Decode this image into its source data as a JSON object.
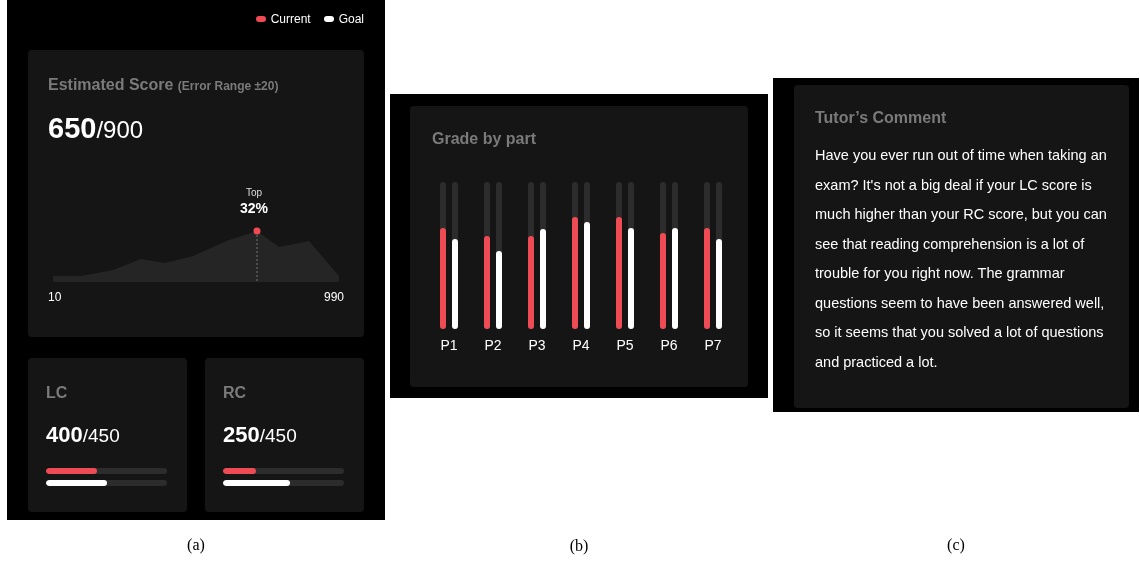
{
  "panels": [
    {
      "caption": "(a)",
      "legend": [
        {
          "label": "Current",
          "color": "#ef4b55"
        },
        {
          "label": "Goal",
          "color": "#ffffff"
        }
      ],
      "estimated": {
        "title": "Estimated Score",
        "note": "(Error Range ±20)",
        "score": "650",
        "total": "/900",
        "marker_caption": "Top",
        "marker_value": "32%",
        "axis_min": "10",
        "axis_max": "990"
      },
      "sections": [
        {
          "title": "LC",
          "score": "400",
          "total": "/450",
          "bars": [
            {
              "kind": "current",
              "level": 0.42
            },
            {
              "kind": "goal",
              "level": 0.5
            }
          ]
        },
        {
          "title": "RC",
          "score": "250",
          "total": "/450",
          "bars": [
            {
              "kind": "current",
              "level": 0.27
            },
            {
              "kind": "goal",
              "level": 0.55
            }
          ]
        }
      ]
    },
    {
      "caption": "(b)",
      "title": "Grade by part",
      "parts": [
        {
          "label": "P1",
          "bars": [
            {
              "kind": "current",
              "level": 0.69
            },
            {
              "kind": "goal",
              "level": 0.61
            }
          ]
        },
        {
          "label": "P2",
          "bars": [
            {
              "kind": "current",
              "level": 0.63
            },
            {
              "kind": "goal",
              "level": 0.53
            }
          ]
        },
        {
          "label": "P3",
          "bars": [
            {
              "kind": "current",
              "level": 0.63
            },
            {
              "kind": "goal",
              "level": 0.68
            }
          ]
        },
        {
          "label": "P4",
          "bars": [
            {
              "kind": "current",
              "level": 0.76
            },
            {
              "kind": "goal",
              "level": 0.73
            }
          ]
        },
        {
          "label": "P5",
          "bars": [
            {
              "kind": "current",
              "level": 0.76
            },
            {
              "kind": "goal",
              "level": 0.69
            }
          ]
        },
        {
          "label": "P6",
          "bars": [
            {
              "kind": "current",
              "level": 0.65
            },
            {
              "kind": "goal",
              "level": 0.69
            }
          ]
        },
        {
          "label": "P7",
          "bars": [
            {
              "kind": "current",
              "level": 0.69
            },
            {
              "kind": "goal",
              "level": 0.61
            }
          ]
        }
      ]
    },
    {
      "caption": "(c)",
      "title": "Tutor’s Comment",
      "text": "Have you ever run out of time when taking an exam? It's not a big deal if your LC score is much higher than your RC score, but you can see that reading comprehension is a lot of trouble for you right now. The grammar questions seem to have been answered well, so it seems that you solved a lot of questions and practiced a lot."
    }
  ]
}
